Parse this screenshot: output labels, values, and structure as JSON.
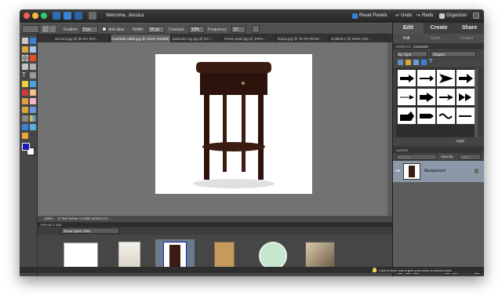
{
  "titlebar": {
    "welcome": "Welcome, Jessica",
    "reset_panels": "Reset Panels",
    "undo": "Undo",
    "redo": "Redo",
    "organizer": "Organizer"
  },
  "options_bar": {
    "feather_label": "Feather:",
    "feather_value": "0 px",
    "anti_alias_label": "Anti-alias",
    "width_label": "Width:",
    "width_value": "10 px",
    "contrast_label": "Contrast:",
    "contrast_value": "10%",
    "frequency_label": "Frequency:",
    "frequency_value": "57"
  },
  "doc_tabs": [
    "armoire.jpg @ 96.4% (RG...",
    "Roadside table.jpg @ 100% (RGB/8)",
    "bedroom rug.jpg @ 93.7...",
    "Green paint.jpg @ 100%...",
    "lamps.jpg @ 79.2% (RGB/...",
    "Untitled-1 @ 100% (RG..."
  ],
  "status": {
    "zoom": "100%",
    "dimensions": "6.759 inches x 6.056 inches (72..."
  },
  "project_bin": {
    "title": "PROJECT BIN",
    "filter": "Show Open Files"
  },
  "right_panel": {
    "modes": [
      "Edit",
      "Create",
      "Share"
    ],
    "subtabs": [
      "Full",
      "Quick",
      "Guided"
    ],
    "panel_tabs": [
      "EFFECTS",
      "CONTENT"
    ],
    "by_type": "By Type",
    "category": "Shapes",
    "apply": "Apply"
  },
  "layers": {
    "title": "LAYERS",
    "blend_mode": "Normal",
    "opacity_label": "Opacity:",
    "opacity_value": "100%",
    "layer_name": "Background",
    "lock_label": "Lock:"
  },
  "hint": "Click to learn how to give your photo a woodcut look.",
  "colors": {
    "foreground": "#1b1bb0",
    "background": "#ffffff",
    "accent": "#e94b24",
    "selection": "#6b7b8b"
  }
}
